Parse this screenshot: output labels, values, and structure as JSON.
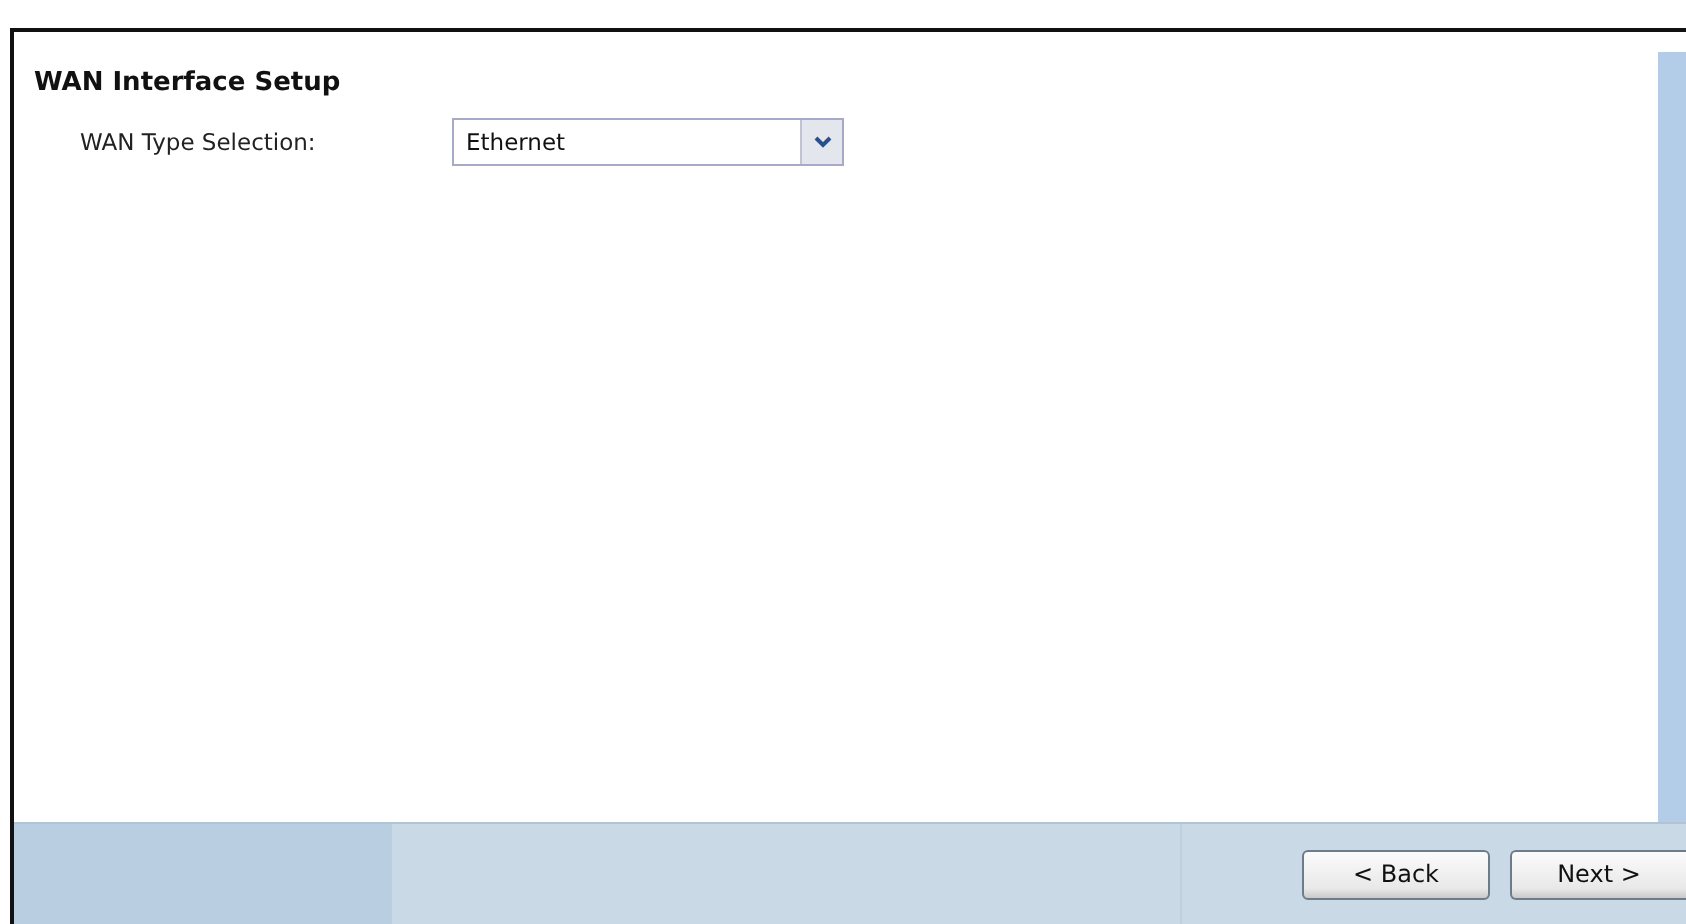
{
  "section": {
    "title": "WAN Interface Setup"
  },
  "fields": [
    {
      "label": "WAN Type Selection:",
      "kind": "select",
      "value": "Ethernet"
    }
  ],
  "buttons": [
    {
      "label": "< Back"
    },
    {
      "label": "Next >"
    }
  ]
}
